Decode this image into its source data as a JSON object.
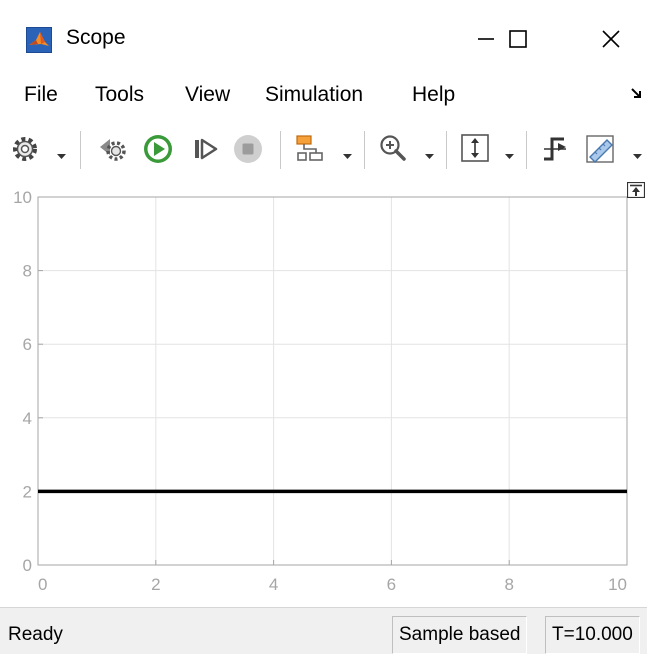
{
  "window": {
    "title": "Scope",
    "icon": "matlab-logo-icon",
    "controls": [
      "minimize-icon",
      "maximize-icon",
      "close-icon"
    ]
  },
  "menu": {
    "items": [
      "File",
      "Tools",
      "View",
      "Simulation",
      "Help"
    ],
    "overflow_icon": "menu-overflow-arrow-icon"
  },
  "toolbar": {
    "buttons": [
      {
        "name": "settings",
        "icon": "gear-icon",
        "dropdown": true
      },
      {
        "name": "step-back",
        "icon": "step-back-icon"
      },
      {
        "name": "run",
        "icon": "play-icon",
        "color": "#3a9a3a"
      },
      {
        "name": "step-forward",
        "icon": "step-forward-icon"
      },
      {
        "name": "stop",
        "icon": "stop-icon",
        "enabled": false
      },
      {
        "name": "highlight-block",
        "icon": "highlight-block-icon",
        "dropdown": true
      },
      {
        "name": "zoom",
        "icon": "zoom-in-icon",
        "dropdown": true
      },
      {
        "name": "autoscale",
        "icon": "scale-axes-icon",
        "dropdown": true
      },
      {
        "name": "triggers",
        "icon": "trigger-icon"
      },
      {
        "name": "measurements",
        "icon": "ruler-icon",
        "dropdown": true
      }
    ]
  },
  "plot": {
    "undock_icon": "undock-icon",
    "background": "#ffffff",
    "grid_color": "#e3e3e3",
    "axis_color": "#a6a6a6",
    "line_color": "#000000"
  },
  "chart_data": {
    "type": "line",
    "xlim": [
      0,
      10
    ],
    "ylim": [
      0,
      10
    ],
    "x_ticks": [
      0,
      2,
      4,
      6,
      8,
      10
    ],
    "y_ticks": [
      0,
      2,
      4,
      6,
      8,
      10
    ],
    "grid": true,
    "series": [
      {
        "x": [
          0,
          10
        ],
        "y": [
          2,
          2
        ]
      }
    ]
  },
  "status": {
    "left": "Ready",
    "mode": "Sample based",
    "time": "T=10.000"
  }
}
